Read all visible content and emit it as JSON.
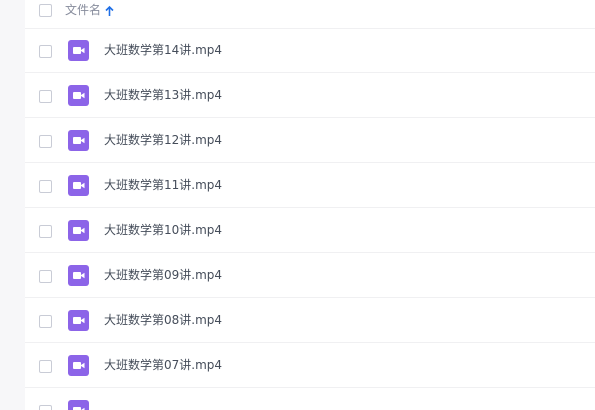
{
  "header": {
    "column_label": "文件名",
    "sort_icon": "arrow-up-icon"
  },
  "file_icon": "video-file-icon",
  "files": [
    {
      "name": "大班数学第14讲.mp4"
    },
    {
      "name": "大班数学第13讲.mp4"
    },
    {
      "name": "大班数学第12讲.mp4"
    },
    {
      "name": "大班数学第11讲.mp4"
    },
    {
      "name": "大班数学第10讲.mp4"
    },
    {
      "name": "大班数学第09讲.mp4"
    },
    {
      "name": "大班数学第08讲.mp4"
    },
    {
      "name": "大班数学第07讲.mp4"
    }
  ],
  "colors": {
    "accent": "#1f6fe6",
    "video_icon": "#8c64e8",
    "text": "#454d5a",
    "header_text": "#878c9c"
  }
}
